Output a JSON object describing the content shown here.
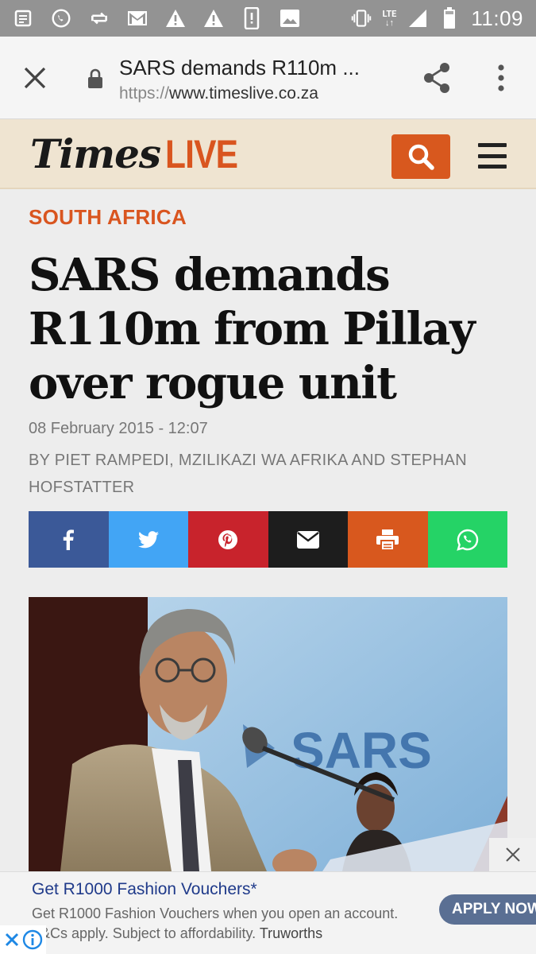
{
  "status_bar": {
    "time": "11:09",
    "network": "LTE"
  },
  "browser": {
    "page_title": "SARS demands R110m ...",
    "url_scheme": "https://",
    "url_host": "www.timeslive.co.za"
  },
  "site": {
    "logo_times": "Times",
    "logo_live": "LIVE",
    "accent_color": "#d8581e"
  },
  "article": {
    "section": "SOUTH AFRICA",
    "headline": "SARS demands R110m from Pillay over rogue unit",
    "date": "08 February 2015 - 12:07",
    "byline": "BY PIET RAMPEDI, MZILIKAZI WA AFRIKA AND STEPHAN HOFSTATTER",
    "share_buttons": [
      {
        "name": "facebook",
        "color": "#3b5998"
      },
      {
        "name": "twitter",
        "color": "#42a5f5"
      },
      {
        "name": "pinterest",
        "color": "#c8232c"
      },
      {
        "name": "email",
        "color": "#1d1d1d"
      },
      {
        "name": "print",
        "color": "#d8581e"
      },
      {
        "name": "whatsapp",
        "color": "#25d366"
      }
    ],
    "photo_sign_text": "SARS"
  },
  "ad": {
    "title": "Get R1000 Fashion Vouchers*",
    "body_line1": "Get R1000 Fashion Vouchers when you open an account.",
    "body_line2": "T&Cs apply. Subject to affordability.",
    "brand": "Truworths",
    "cta": "APPLY NOW"
  }
}
